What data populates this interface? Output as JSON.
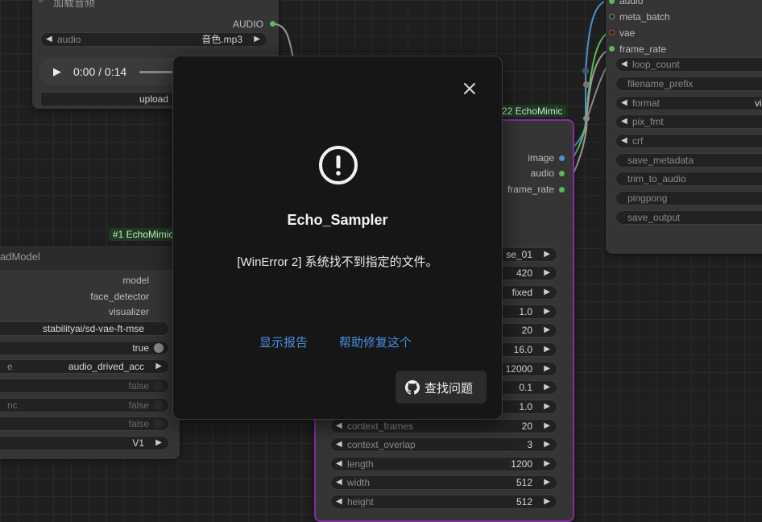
{
  "background": {
    "audio_node": {
      "title": "加载音频",
      "output_audio": "AUDIO",
      "audio_widget": {
        "label": "audio",
        "value": "音色.mp3"
      },
      "player": {
        "time": "0:00 / 0:14"
      },
      "upload_label": "upload"
    },
    "right_node": {
      "outputs": [
        "audio",
        "meta_batch",
        "vae",
        "frame_rate"
      ],
      "widgets": [
        {
          "label": "loop_count",
          "value": ""
        },
        {
          "label": "filename_prefix",
          "value": ""
        },
        {
          "label": "format",
          "value": "vi"
        },
        {
          "label": "pix_fmt",
          "value": ""
        },
        {
          "label": "crf",
          "value": ""
        },
        {
          "label": "save_metadata",
          "value": ""
        },
        {
          "label": "trim_to_audio",
          "value": ""
        },
        {
          "label": "pingpong",
          "value": ""
        },
        {
          "label": "save_output",
          "value": ""
        }
      ]
    },
    "load_model_node": {
      "badge": "#1 EchoMimic",
      "title": "adModel",
      "outputs": [
        "model",
        "face_detector",
        "visualizer"
      ],
      "widgets": [
        {
          "label": "",
          "value": "stabilityai/sd-vae-ft-mse"
        },
        {
          "label": "",
          "value": "true"
        },
        {
          "label": "e",
          "value": "audio_drived_acc"
        },
        {
          "label": "",
          "value": "false"
        },
        {
          "label": "nc",
          "value": "false"
        },
        {
          "label": "",
          "value": "false"
        },
        {
          "label": "",
          "value": "V1"
        }
      ]
    },
    "sampler_node": {
      "badge": "22 EchoMimic",
      "outputs": [
        "image",
        "audio",
        "frame_rate"
      ],
      "widgets": [
        {
          "label": "",
          "value": "se_01"
        },
        {
          "label": "",
          "value": "420"
        },
        {
          "label": "",
          "value": "fixed"
        },
        {
          "label": "",
          "value": "1.0"
        },
        {
          "label": "",
          "value": "20"
        },
        {
          "label": "",
          "value": "16.0"
        },
        {
          "label": "",
          "value": "12000"
        },
        {
          "label": "",
          "value": "0.1"
        },
        {
          "label": "",
          "value": "1.0"
        },
        {
          "label": "context_frames",
          "value": "20"
        },
        {
          "label": "context_overlap",
          "value": "3"
        },
        {
          "label": "length",
          "value": "1200"
        },
        {
          "label": "width",
          "value": "512"
        },
        {
          "label": "height",
          "value": "512"
        }
      ]
    }
  },
  "dialog": {
    "title": "Echo_Sampler",
    "message": "[WinError 2] 系统找不到指定的文件。",
    "show_report": "显示报告",
    "help_fix": "帮助修复这个",
    "find_issues": "查找问题"
  },
  "icons": [
    "close-icon",
    "alert-circle-icon",
    "github-icon",
    "play-icon",
    "arrow-left-icon",
    "arrow-right-icon"
  ],
  "colors": {
    "link": "#4a8fe0",
    "dialog_bg": "#161617",
    "canvas_bg": "#1f1f1f",
    "slot_green": "#5bb85b",
    "slot_blue": "#4d8fcf",
    "slot_red": "#c04848",
    "sampler_border": "#8a2aa8"
  }
}
